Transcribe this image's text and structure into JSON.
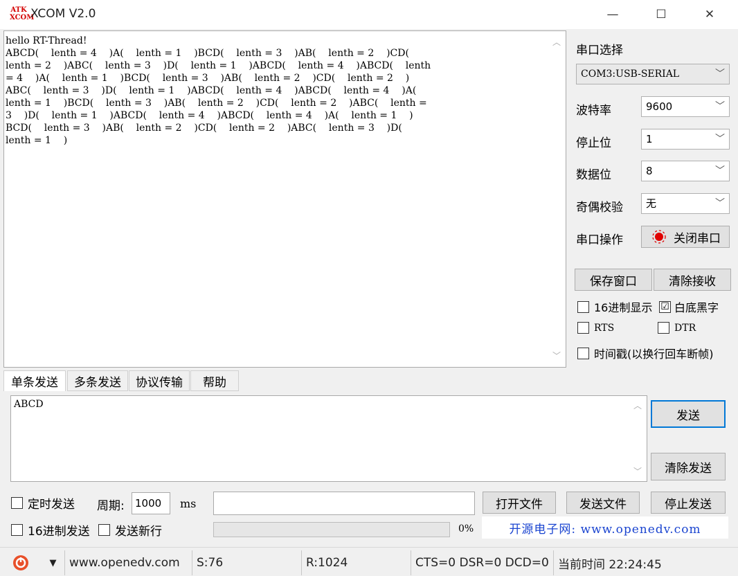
{
  "window": {
    "logo": "ATK XCOM",
    "title": "XCOM V2.0",
    "minimize": "—",
    "maximize": "☐",
    "close": "✕"
  },
  "receive": {
    "text": "hello RT-Thread!\nABCD(    lenth = 4    )A(    lenth = 1    )BCD(    lenth = 3    )AB(    lenth = 2    )CD(\nlenth = 2    )ABC(    lenth = 3    )D(    lenth = 1    )ABCD(    lenth = 4    )ABCD(    lenth\n= 4    )A(    lenth = 1    )BCD(    lenth = 3    )AB(    lenth = 2    )CD(    lenth = 2    )\nABC(    lenth = 3    )D(    lenth = 1    )ABCD(    lenth = 4    )ABCD(    lenth = 4    )A(\nlenth = 1    )BCD(    lenth = 3    )AB(    lenth = 2    )CD(    lenth = 2    )ABC(    lenth =\n3    )D(    lenth = 1    )ABCD(    lenth = 4    )ABCD(    lenth = 4    )A(    lenth = 1    )\nBCD(    lenth = 3    )AB(    lenth = 2    )CD(    lenth = 2    )ABC(    lenth = 3    )D(\nlenth = 1    )"
  },
  "serial": {
    "port_label": "串口选择",
    "port_value": "COM3:USB-SERIAL",
    "baud_label": "波特率",
    "baud_value": "9600",
    "stop_label": "停止位",
    "stop_value": "1",
    "data_label": "数据位",
    "data_value": "8",
    "parity_label": "奇偶校验",
    "parity_value": "无",
    "op_label": "串口操作",
    "op_button": "关闭串口",
    "op_indicator_color": "#e00000"
  },
  "side_buttons": {
    "save": "保存窗口",
    "clear_recv": "清除接收"
  },
  "options": {
    "hex_display": "16进制显示",
    "white_black": "白底黑字",
    "white_black_checked": "☑",
    "rts": "RTS",
    "dtr": "DTR",
    "timestamp": "时间戳(以换行回车断帧)"
  },
  "tabs": [
    "单条发送",
    "多条发送",
    "协议传输",
    "帮助"
  ],
  "send": {
    "text": "ABCD",
    "send_button": "发送",
    "clear_button": "清除发送"
  },
  "bottom": {
    "timed_send": "定时发送",
    "period_label": "周期:",
    "period_value": "1000",
    "period_unit": "ms",
    "open_file": "打开文件",
    "send_file": "发送文件",
    "stop_send": "停止发送",
    "hex_send": "16进制发送",
    "send_newline": "发送新行",
    "progress_text": "0%",
    "promo": "开源电子网: www.openedv.com"
  },
  "statusbar": {
    "dropdown": "▼",
    "website": "www.openedv.com",
    "sent": "S:76",
    "received": "R:1024",
    "lines": "CTS=0 DSR=0 DCD=0",
    "time": "当前时间 22:24:45"
  }
}
